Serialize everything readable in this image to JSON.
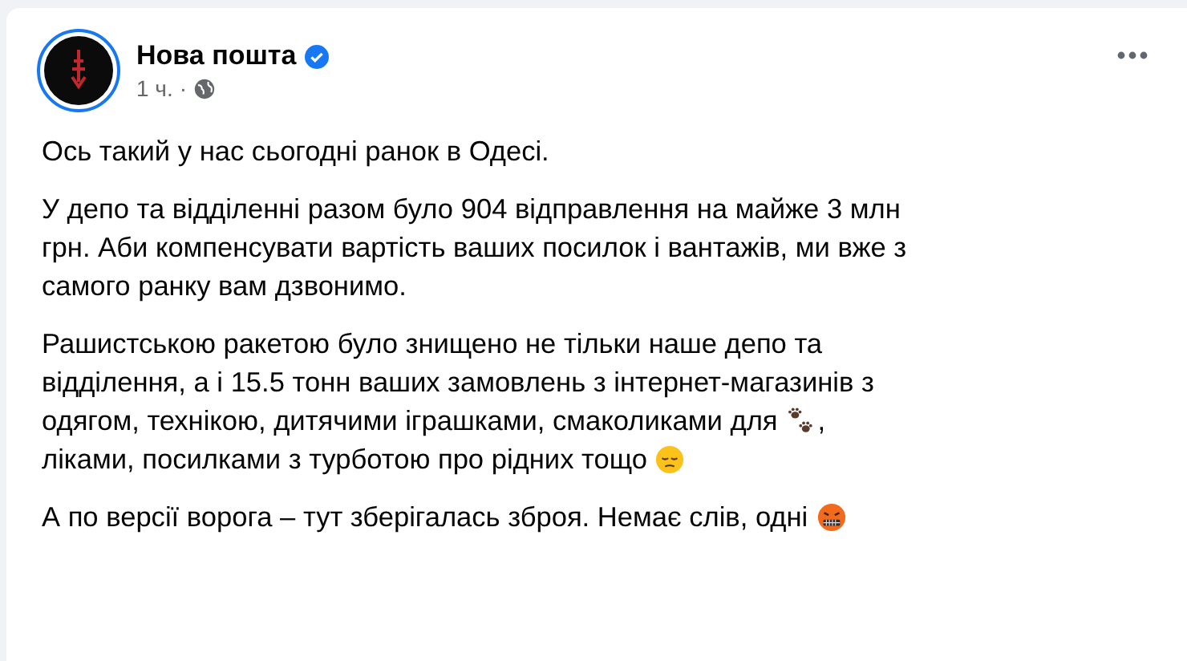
{
  "post": {
    "author": "Нова пошта",
    "verified": true,
    "time": "1 ч.",
    "separator": "·",
    "paragraphs": [
      [
        [
          {
            "kind": "text",
            "text": "Ось такий у нас сьогодні ранок в Одесі."
          }
        ]
      ],
      [
        [
          {
            "kind": "text",
            "text": "У депо та відділенні разом було 904 відправлення на майже 3 млн"
          }
        ],
        [
          {
            "kind": "text",
            "text": "грн. Аби компенсувати вартість ваших посилок і вантажів, ми вже з"
          }
        ],
        [
          {
            "kind": "text",
            "text": "самого ранку вам дзвонимо."
          }
        ]
      ],
      [
        [
          {
            "kind": "text",
            "text": "Рашистською ракетою було знищено не тільки наше депо та"
          }
        ],
        [
          {
            "kind": "text",
            "text": "відділення, а і 15.5 тонн ваших замовлень з інтернет-магазинів з"
          }
        ],
        [
          {
            "kind": "text",
            "text": "одягом, технікою, дитячими іграшками, смаколиками для"
          },
          {
            "kind": "paws"
          },
          {
            "kind": "text",
            "text": ","
          }
        ],
        [
          {
            "kind": "text",
            "text": "ліками, посилками з турботою про рідних тощо"
          },
          {
            "kind": "pensive"
          }
        ]
      ],
      [
        [
          {
            "kind": "text",
            "text": "А по версії ворога – тут зберігалась зброя. Немає слів, одні"
          },
          {
            "kind": "angry"
          }
        ]
      ]
    ]
  }
}
